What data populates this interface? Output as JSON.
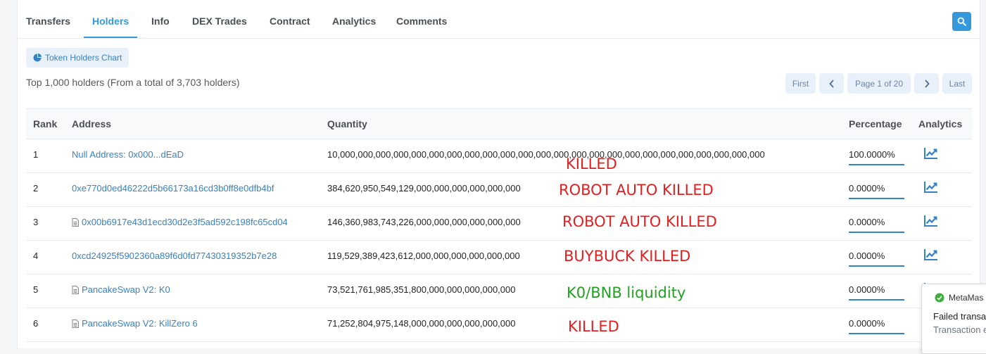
{
  "tabs": [
    {
      "label": "Transfers"
    },
    {
      "label": "Holders"
    },
    {
      "label": "Info"
    },
    {
      "label": "DEX Trades"
    },
    {
      "label": "Contract"
    },
    {
      "label": "Analytics"
    },
    {
      "label": "Comments"
    }
  ],
  "chart_button": {
    "label": "Token Holders Chart",
    "icon": "pie-chart-icon"
  },
  "summary": "Top 1,000 holders (From a total of 3,703 holders)",
  "pagination": {
    "first": "First",
    "prev": "‹",
    "page_info": "Page 1 of 20",
    "next": "›",
    "last": "Last"
  },
  "columns": {
    "rank": "Rank",
    "address": "Address",
    "quantity": "Quantity",
    "percentage": "Percentage",
    "analytics": "Analytics"
  },
  "rows": [
    {
      "rank": "1",
      "address": "Null Address: 0x000...dEaD",
      "contract": false,
      "quantity": "10,000,000,000,000,000,000,000,000,000,000,000,000,000,000,000,000,000,000,000,000,000,000,000,000",
      "percentage": "100.0000%"
    },
    {
      "rank": "2",
      "address": "0xe770d0ed46222d5b66173a16cd3b0ff8e0dfb4bf",
      "contract": false,
      "quantity": "384,620,950,549,129,000,000,000,000,000,000",
      "percentage": "0.0000%"
    },
    {
      "rank": "3",
      "address": "0x00b6917e43d1ecd30d2e3f5ad592c198fc65cd04",
      "contract": true,
      "quantity": "146,360,983,743,226,000,000,000,000,000,000",
      "percentage": "0.0000%"
    },
    {
      "rank": "4",
      "address": "0xcd24925f5902360a89f6d0fd77430319352b7e28",
      "contract": false,
      "quantity": "119,529,389,423,612,000,000,000,000,000,000",
      "percentage": "0.0000%"
    },
    {
      "rank": "5",
      "address": "PancakeSwap V2: K0",
      "contract": true,
      "quantity": "73,521,761,985,351,800,000,000,000,000,000",
      "percentage": "0.0000%"
    },
    {
      "rank": "6",
      "address": "PancakeSwap V2: KillZero 6",
      "contract": true,
      "quantity": "71,252,804,975,148,000,000,000,000,000,000",
      "percentage": "0.0000%"
    }
  ],
  "annotations": [
    {
      "text": "KILLED",
      "color": "#e02020"
    },
    {
      "text": "ROBOT  AUTO KILLED",
      "color": "#e02020"
    },
    {
      "text": "ROBOT AUTO KILLED",
      "color": "#e02020"
    },
    {
      "text": "BUYBUCK  KILLED",
      "color": "#e02020"
    },
    {
      "text": "K0/BNB liquidity",
      "color": "#22a022"
    },
    {
      "text": "KILLED",
      "color": "#e02020"
    }
  ],
  "metamask": {
    "title": "MetaMas",
    "failed": "Failed transa",
    "body": "Transaction encountered"
  },
  "colors": {
    "accent": "#3498db",
    "link": "#3582c6"
  }
}
